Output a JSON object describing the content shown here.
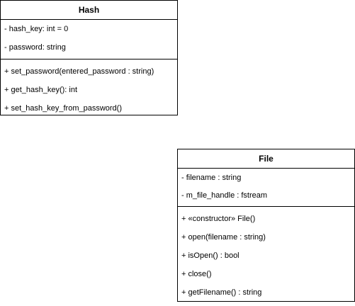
{
  "classes": {
    "hash": {
      "name": "Hash",
      "attributes": [
        "- hash_key: int = 0",
        "- password: string"
      ],
      "operations": [
        "+ set_password(entered_password : string)",
        "+ get_hash_key(): int",
        "+ set_hash_key_from_password()"
      ]
    },
    "file": {
      "name": "File",
      "attributes": [
        "- filename : string",
        "- m_file_handle : fstream"
      ],
      "operations": [
        "+ «constructor» File()",
        "+ open(filename : string)",
        "+ isOpen() : bool",
        "+ close()",
        "+ getFilename() : string"
      ]
    }
  }
}
